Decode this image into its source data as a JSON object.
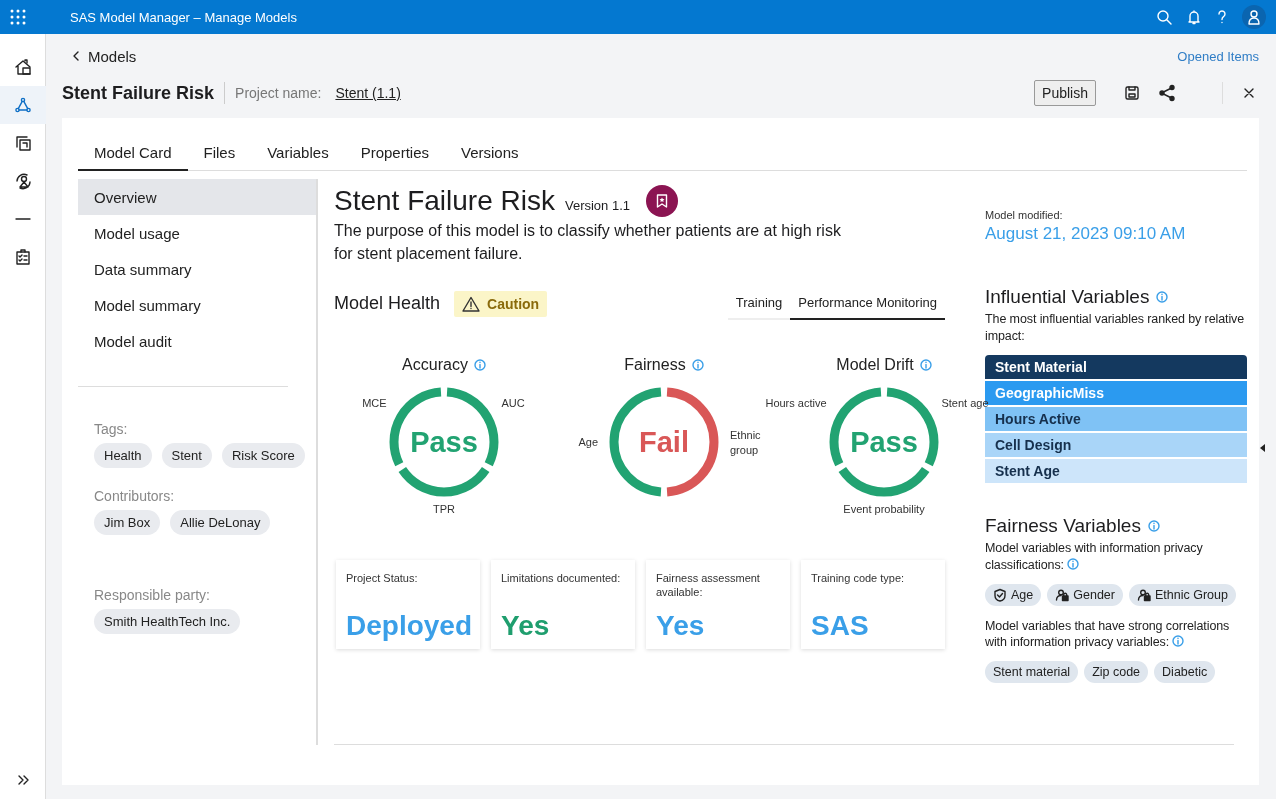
{
  "app_bar": {
    "title": "SAS Model Manager – Manage Models"
  },
  "nav_rail": {
    "items": [
      {
        "kind": "home",
        "selected": false
      },
      {
        "kind": "nodes",
        "selected": true
      },
      {
        "kind": "pages",
        "selected": false
      },
      {
        "kind": "person",
        "selected": false
      },
      {
        "kind": "dash",
        "selected": false
      },
      {
        "kind": "clipboard",
        "selected": false
      }
    ]
  },
  "breadcrumb": {
    "back_link": "Models",
    "opened_items": "Opened Items"
  },
  "header": {
    "title": "Stent Failure Risk",
    "project_label": "Project name:",
    "project_link": "Stent (1.1)",
    "publish_button": "Publish"
  },
  "tabs": [
    {
      "label": "Model Card",
      "selected": true
    },
    {
      "label": "Files",
      "selected": false
    },
    {
      "label": "Variables",
      "selected": false
    },
    {
      "label": "Properties",
      "selected": false
    },
    {
      "label": "Versions",
      "selected": false
    }
  ],
  "sections": [
    {
      "label": "Overview",
      "selected": true
    },
    {
      "label": "Model usage",
      "selected": false
    },
    {
      "label": "Data summary",
      "selected": false
    },
    {
      "label": "Model summary",
      "selected": false
    },
    {
      "label": "Model audit",
      "selected": false
    }
  ],
  "tags": {
    "label": "Tags:",
    "items": [
      "Health",
      "Stent",
      "Risk Score"
    ]
  },
  "contributors": {
    "label": "Contributors:",
    "items": [
      "Jim Box",
      "Allie DeLonay"
    ]
  },
  "responsible_party": {
    "label": "Responsible party:",
    "items": [
      "Smith HealthTech Inc."
    ]
  },
  "overview": {
    "title": "Stent Failure Risk",
    "version": "Version 1.1",
    "description": "The purpose of this model is to classify whether patients are at high risk for stent placement failure.",
    "health": {
      "title": "Model Health",
      "status": {
        "label": "Caution",
        "kind": "caution"
      },
      "view_tabs": [
        {
          "label": "Training",
          "selected": false
        },
        {
          "label": "Performance Monitoring",
          "selected": true
        }
      ],
      "gauges": [
        {
          "title": "Accuracy",
          "result": "Pass",
          "kind": "pass",
          "segments": [
            {
              "label": "MCE",
              "failed": false
            },
            {
              "label": "AUC",
              "failed": false
            },
            {
              "label": "TPR",
              "failed": false
            }
          ]
        },
        {
          "title": "Fairness",
          "result": "Fail",
          "kind": "fail",
          "segments": [
            {
              "label": "Age",
              "failed": false
            },
            {
              "label": "Ethnic group",
              "failed": true
            }
          ]
        },
        {
          "title": "Model Drift",
          "result": "Pass",
          "kind": "pass",
          "segments": [
            {
              "label": "Hours active",
              "failed": false
            },
            {
              "label": "Stent age",
              "failed": false
            },
            {
              "label": "Event probability",
              "failed": false
            }
          ]
        }
      ]
    },
    "stats": [
      {
        "label": "Project Status:",
        "value": "Deployed",
        "color": "#3a9fe8"
      },
      {
        "label": "Limitations documented:",
        "value": "Yes",
        "color": "#1f9e6e"
      },
      {
        "label": "Fairness assessment available:",
        "value": "Yes",
        "color": "#3a9fe8"
      },
      {
        "label": "Training code type:",
        "value": "SAS",
        "color": "#3a9fe8"
      }
    ]
  },
  "details": {
    "modified_label": "Model modified:",
    "modified_date": "August 21, 2023 09:10 AM",
    "influential": {
      "title": "Influential Variables",
      "description": "The most influential variables ranked by relative impact:",
      "items": [
        {
          "label": "Stent Material",
          "color": "#14395f"
        },
        {
          "label": "GeographicMiss",
          "color": "#2b9af0"
        },
        {
          "label": "Hours Active",
          "color": "#7fc2f5"
        },
        {
          "label": "Cell Design",
          "color": "#a9d5f8"
        },
        {
          "label": "Stent Age",
          "color": "#cde5fa"
        }
      ]
    },
    "fairness": {
      "title": "Fairness Variables",
      "privacy_description": "Model variables with information privacy classifications:",
      "privacy_items": [
        {
          "label": "Age",
          "kind": "shield"
        },
        {
          "label": "Gender",
          "kind": "lock"
        },
        {
          "label": "Ethnic Group",
          "kind": "lock"
        }
      ],
      "correlated_description": "Model variables that have strong correlations with information privacy variables:",
      "correlated_items": [
        "Stent material",
        "Zip code",
        "Diabetic"
      ]
    }
  }
}
